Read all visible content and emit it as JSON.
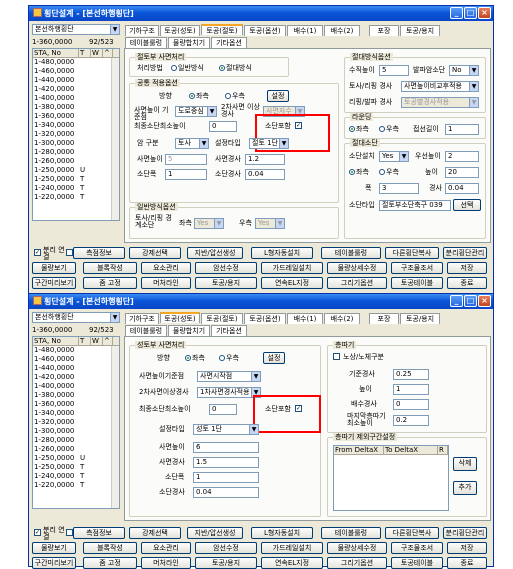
{
  "top": {
    "title": "횡단설계 - [본선하행횡단]",
    "combo": "본선하행횡단",
    "station_label": "1-360,0000",
    "count": "92/523",
    "list_headers": [
      "STA, No",
      "T",
      "W",
      "^"
    ],
    "list_rows": [
      [
        "1-480,0000",
        ""
      ],
      [
        "1-460,0000",
        ""
      ],
      [
        "1-440,0000",
        ""
      ],
      [
        "1-420,0000",
        ""
      ],
      [
        "1-400,0000",
        ""
      ],
      [
        "1-380,0000",
        ""
      ],
      [
        "1-360,0000",
        ""
      ],
      [
        "1-340,0000",
        ""
      ],
      [
        "1-320,0000",
        ""
      ],
      [
        "1-300,0000",
        ""
      ],
      [
        "1-280,0000",
        ""
      ],
      [
        "1-260,0000",
        ""
      ],
      [
        "1-250,0000",
        "U"
      ],
      [
        "1-250,0000",
        "T"
      ],
      [
        "1-240,0000",
        "T"
      ],
      [
        "1-220,0000",
        "T"
      ]
    ],
    "tabs": [
      "기하구조",
      "토공(성토)",
      "토공(절토)",
      "토공(옵션)",
      "배수(1)",
      "배수(2)",
      "포장",
      "토공/용지"
    ],
    "tabs2": [
      "테이블룰렁",
      "물량합치기",
      "기타옵션"
    ],
    "cut_method": {
      "title": "절토부 사면처리",
      "label": "처리방법",
      "opt1": "일반방식",
      "opt2": "절대방식"
    },
    "common": {
      "title": "공통 적용옵션",
      "dir": "방향",
      "left": "좌측",
      "right": "우측",
      "set": "설정",
      "r1": "사면높이 기준점",
      "r1v": "도로중심",
      "r2": "2차사면 이상경사",
      "r2v": "사면자수",
      "min_h": "최종소단최소높이",
      "min_hv": "0",
      "include": "소단포함",
      "rock": "암 구분",
      "rockv": "토사",
      "settype": "설정타입",
      "settypev": "절토 1단",
      "slope_h": "사면높이",
      "slope_hv": "5",
      "slope_g": "사면경사",
      "slope_gv": "1.2",
      "berm_h": "소단폭",
      "berm_hv": "1",
      "berm_g": "소단경사",
      "berm_gv": "0.04"
    },
    "normal": {
      "title": "일반방식옵션",
      "label": "토사/리핑 경계소단",
      "left": "좌측",
      "lv": "Yes",
      "right": "우측",
      "rv": "Yes"
    },
    "abs": {
      "title": "절대방식옵션",
      "n": "수직높이",
      "nv": "5",
      "blast": "발파암소단",
      "blastv": "No",
      "soil": "토사/리핑 경사",
      "soilv": "사면높이비교후적용",
      "rip": "리핑/발파 경사",
      "ripv": "토공별경사적용"
    },
    "round": {
      "title": "라운딩",
      "left": "좌측",
      "right": "우측",
      "tan": "접선길이",
      "tanv": "1"
    },
    "absberm": {
      "title": "절대소단",
      "inst": "소단설치",
      "instv": "Yes",
      "pri": "우선높이",
      "priv": "2",
      "left": "좌측",
      "right": "우측",
      "h": "높이",
      "hv": "20",
      "w": "폭",
      "wv": "3",
      "g": "경사",
      "gv": "0.04",
      "type": "소단타입",
      "typev": "절토부소단축구 039",
      "sel": "선택"
    },
    "bottom_row1": [
      "분리 연결",
      "측점정보",
      "강제선택",
      "지반/압선생성",
      "L형자동설치",
      "테이블룰렁",
      "다른횡단복사",
      "분리횡단관리"
    ],
    "bottom_row2": [
      "물량보기",
      "블록작성",
      "요소관리",
      "암선수정",
      "가드레일설치",
      "물량상세수정",
      "구조물조서",
      "저장"
    ],
    "bottom_row3": [
      "구간미리보기",
      "줌 고정",
      "머처라인",
      "토공/용지",
      "연속EL지정",
      "그리기옵션",
      "토공테이블",
      "종료"
    ]
  },
  "bottom": {
    "title": "횡단설계 - [본선하행횡단]",
    "combo": "본선하행횡단",
    "station_label": "1-360,0000",
    "count": "92/523",
    "cut": {
      "title": "성토부 사면처리",
      "dir": "방향",
      "left": "좌측",
      "right": "우측",
      "set": "설정",
      "r1": "사면높이기준점",
      "r1v": "사면시작점",
      "r2": "2차사면이상경사",
      "r2v": "1차사면경사적용",
      "min_h": "최종소단최소높이",
      "min_hv": "0",
      "include": "소단포함",
      "settype": "설정타입",
      "settypev": "성토 1단",
      "slope_h": "사면높이",
      "slope_hv": "6",
      "slope_g": "사면경사",
      "slope_gv": "1.5",
      "berm_w": "소단폭",
      "berm_wv": "1",
      "berm_g": "소단경사",
      "berm_gv": "0.04"
    },
    "fill": {
      "title": "층따기",
      "chk": "노상/노체구분",
      "base": "기준경사",
      "basev": "0.25",
      "h": "높이",
      "hv": "1",
      "drain": "배수경사",
      "drainv": "0",
      "last": "마지막층따기 최소높이",
      "lastv": "0.2"
    },
    "excl": {
      "title": "층따기 제외구간설정",
      "cols": [
        "From DeltaX",
        "To DeltaX",
        "R"
      ],
      "del": "삭제",
      "add": "추가"
    }
  }
}
